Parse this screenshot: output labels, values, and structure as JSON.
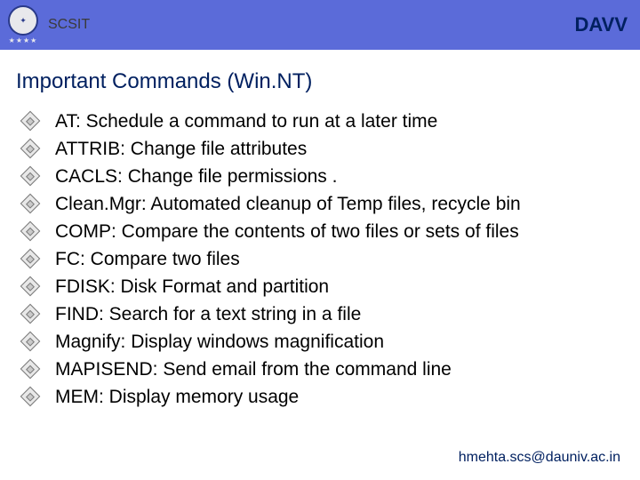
{
  "header": {
    "left_label": "SCSIT",
    "right_label": "DAVV"
  },
  "title": "Important Commands (Win.NT)",
  "items": [
    "AT: Schedule a command to run at a later time",
    "ATTRIB: Change file attributes",
    "CACLS: Change file permissions .",
    "Clean.Mgr: Automated cleanup of Temp files, recycle bin",
    "COMP: Compare the contents of two files or sets of files",
    "FC: Compare two files",
    "FDISK: Disk Format and partition",
    "FIND: Search for a text string in a file",
    "Magnify: Display windows magnification",
    "MAPISEND: Send email from the command line",
    "MEM: Display memory usage"
  ],
  "footer": "hmehta.scs@dauniv.ac.in"
}
